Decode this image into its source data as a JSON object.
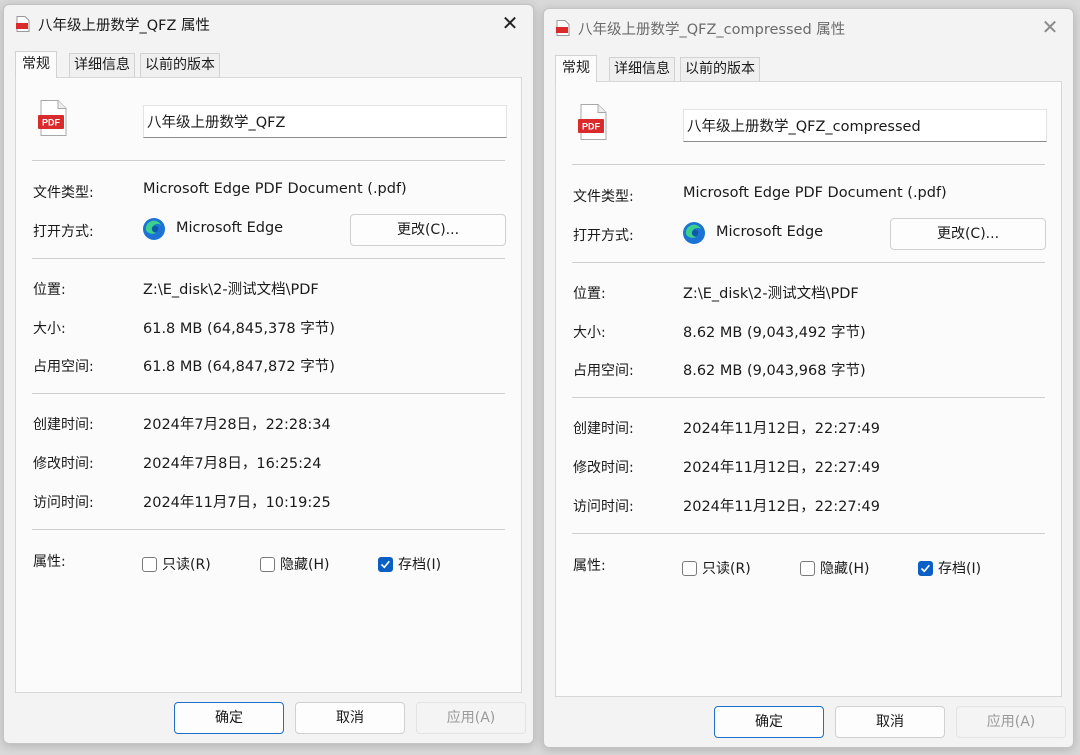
{
  "dialogs": [
    {
      "title": "八年级上册数学_QFZ 属性",
      "tabs": [
        "常规",
        "详细信息",
        "以前的版本"
      ],
      "file_name": "八年级上册数学_QFZ",
      "file_icon_label": "PDF",
      "labels": {
        "type": "文件类型:",
        "open_with": "打开方式:",
        "location": "位置:",
        "size": "大小:",
        "size_on_disk": "占用空间:",
        "created": "创建时间:",
        "modified": "修改时间:",
        "accessed": "访问时间:",
        "attributes": "属性:"
      },
      "file_type": "Microsoft Edge PDF Document (.pdf)",
      "open_with_app": "Microsoft Edge",
      "change_button": "更改(C)...",
      "location": "Z:\\E_disk\\2-测试文档\\PDF",
      "size": "61.8 MB (64,845,378 字节)",
      "size_on_disk": "61.8 MB (64,847,872 字节)",
      "created": "2024年7月28日，22:28:34",
      "modified": "2024年7月8日，16:25:24",
      "accessed": "2024年11月7日，10:19:25",
      "attributes": {
        "readonly": {
          "label": "只读(R)",
          "checked": false
        },
        "hidden": {
          "label": "隐藏(H)",
          "checked": false
        },
        "archive": {
          "label": "存档(I)",
          "checked": true
        }
      },
      "buttons": {
        "ok": "确定",
        "cancel": "取消",
        "apply": "应用(A)"
      }
    },
    {
      "title": "八年级上册数学_QFZ_compressed 属性",
      "tabs": [
        "常规",
        "详细信息",
        "以前的版本"
      ],
      "file_name": "八年级上册数学_QFZ_compressed",
      "file_icon_label": "PDF",
      "labels": {
        "type": "文件类型:",
        "open_with": "打开方式:",
        "location": "位置:",
        "size": "大小:",
        "size_on_disk": "占用空间:",
        "created": "创建时间:",
        "modified": "修改时间:",
        "accessed": "访问时间:",
        "attributes": "属性:"
      },
      "file_type": "Microsoft Edge PDF Document (.pdf)",
      "open_with_app": "Microsoft Edge",
      "change_button": "更改(C)...",
      "location": "Z:\\E_disk\\2-测试文档\\PDF",
      "size": "8.62 MB (9,043,492 字节)",
      "size_on_disk": "8.62 MB (9,043,968 字节)",
      "created": "2024年11月12日，22:27:49",
      "modified": "2024年11月12日，22:27:49",
      "accessed": "2024年11月12日，22:27:49",
      "attributes": {
        "readonly": {
          "label": "只读(R)",
          "checked": false
        },
        "hidden": {
          "label": "隐藏(H)",
          "checked": false
        },
        "archive": {
          "label": "存档(I)",
          "checked": true
        }
      },
      "buttons": {
        "ok": "确定",
        "cancel": "取消",
        "apply": "应用(A)"
      }
    }
  ],
  "colors": {
    "accent": "#0a5fc4",
    "pdf_red": "#d92b2b"
  },
  "icons": {
    "file": "pdf-file-icon",
    "app": "microsoft-edge-icon",
    "close": "close-icon",
    "check": "checkmark-icon"
  }
}
